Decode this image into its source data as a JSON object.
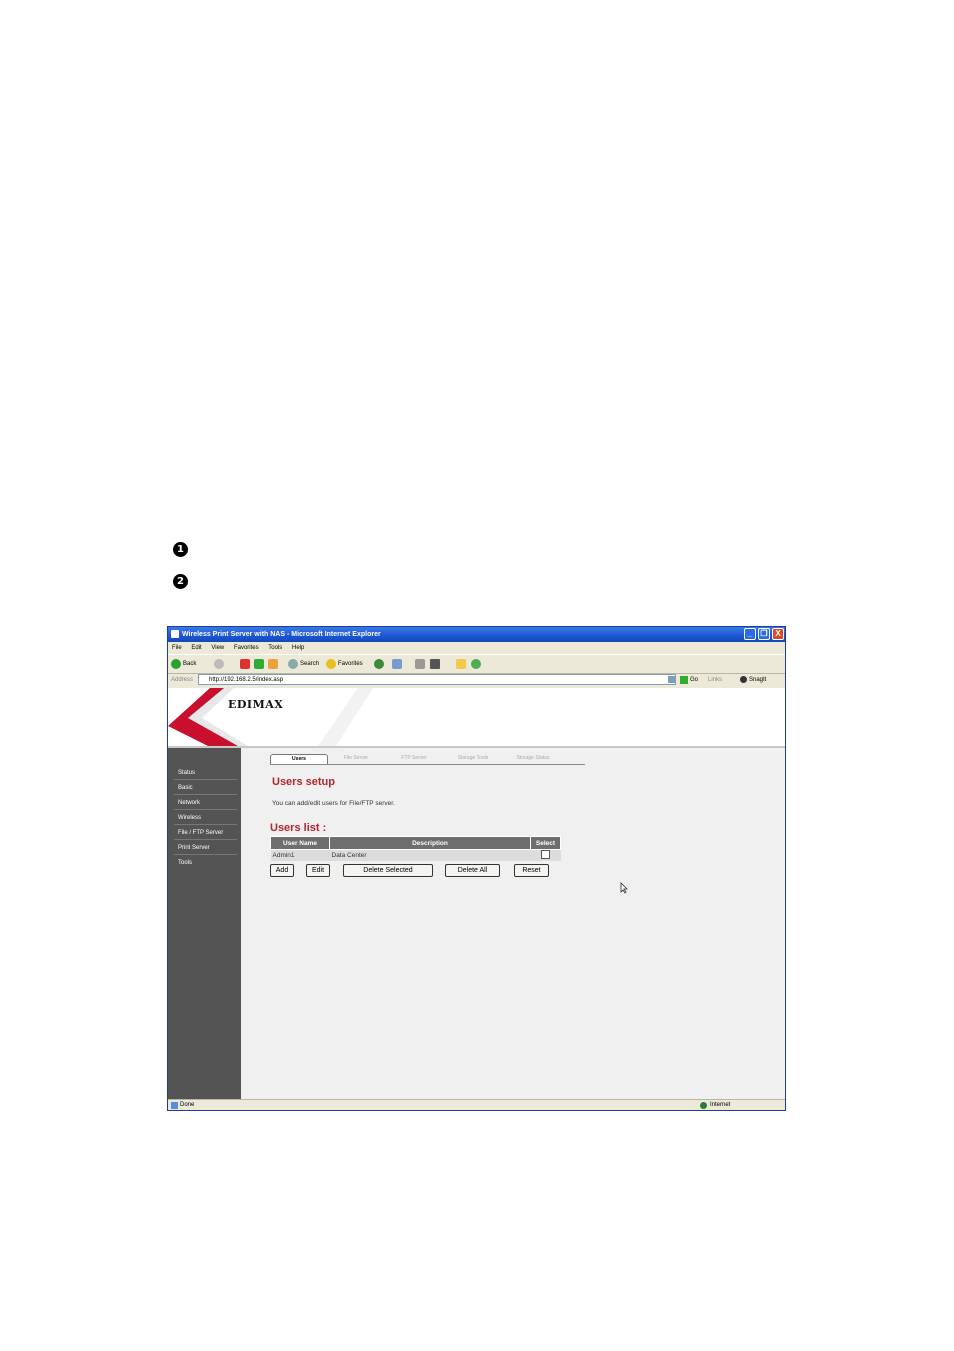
{
  "window": {
    "title": "Wireless Print Server with NAS - Microsoft Internet Explorer",
    "min_glyph": "_",
    "max_glyph": "❐",
    "close_glyph": "X"
  },
  "menu": [
    "File",
    "Edit",
    "View",
    "Favorites",
    "Tools",
    "Help"
  ],
  "toolbar": {
    "back": "Back",
    "search": "Search",
    "favorites": "Favorites"
  },
  "address": {
    "label": "Address",
    "url": "http://192.168.2.5/index.asp",
    "go": "Go",
    "links": "Links",
    "snagit": "SnagIt"
  },
  "brand": {
    "logo": "EDIMAX"
  },
  "sidebar": [
    "Status",
    "Basic",
    "Network",
    "Wireless",
    "File / FTP Server",
    "Print Server",
    "Tools"
  ],
  "tabs": [
    "Users",
    "File Server",
    "FTP Server",
    "Storage Tools",
    "Storage Status"
  ],
  "page": {
    "setup_title": "Users setup",
    "description": "You can add/edit users for File/FTP server.",
    "list_title": "Users list :"
  },
  "table": {
    "columns": [
      "User Name",
      "Description",
      "Select"
    ],
    "rows": [
      {
        "user": "Admin1",
        "description": "Data Center"
      }
    ]
  },
  "buttons": {
    "add": "Add",
    "edit": "Edit",
    "delete_selected": "Delete Selected",
    "delete_all": "Delete All",
    "reset": "Reset"
  },
  "status": {
    "left": "Done",
    "zone": "Internet"
  },
  "bullets": [
    "❶",
    "❷"
  ],
  "colors": {
    "accent_red": "#b3262e",
    "sidebar": "#545454",
    "titlebar": "#1c56d3"
  }
}
